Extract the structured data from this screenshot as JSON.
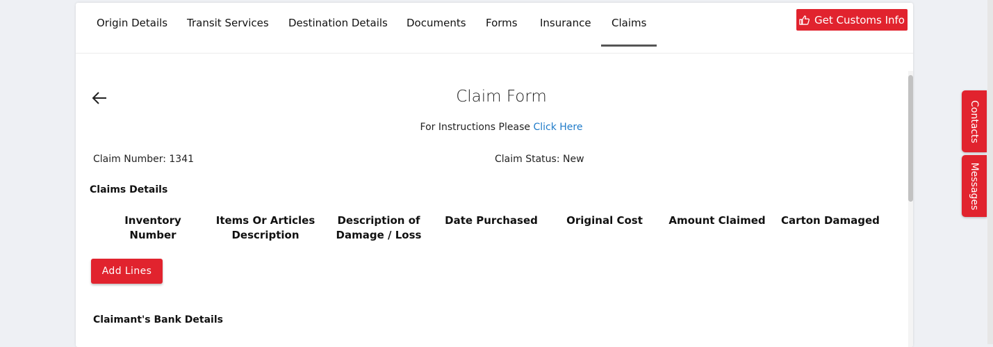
{
  "tabs": [
    {
      "label": "Origin Details"
    },
    {
      "label": "Transit Services"
    },
    {
      "label": "Destination Details"
    },
    {
      "label": "Documents"
    },
    {
      "label": "Forms"
    },
    {
      "label": "Insurance"
    },
    {
      "label": "Claims",
      "active": true
    }
  ],
  "customs_button": {
    "label": "Get Customs Info",
    "icon": "thumbs-up-icon"
  },
  "form": {
    "title": "Claim Form",
    "instructions_text": "For Instructions Please ",
    "instructions_link": "Click Here",
    "claim_number": "Claim Number: 1341",
    "claim_status": "Claim Status: New",
    "claims_details_title": "Claims Details",
    "columns": [
      "Inventory Number",
      "Items Or Articles Description",
      "Description of Damage / Loss",
      "Date Purchased",
      "Original Cost",
      "Amount Claimed",
      "Carton Damaged"
    ],
    "add_lines_label": "Add Lines",
    "bank_details_title": "Claimant's Bank Details"
  },
  "side_tabs": {
    "contacts": "Contacts",
    "messages": "Messages"
  },
  "colors": {
    "accent": "#e1232e",
    "link": "#1f7bc9",
    "active_underline": "#555555"
  }
}
